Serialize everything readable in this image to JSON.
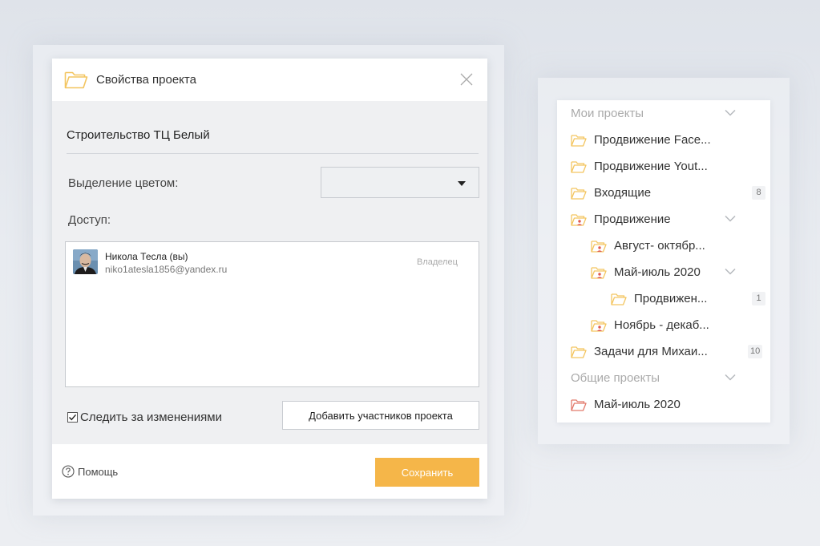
{
  "dialog": {
    "title": "Свойства проекта",
    "project_name": "Строительство ТЦ Белый",
    "color_label": "Выделение цветом:",
    "color_value": "",
    "access_label": "Доступ:",
    "members": [
      {
        "name": "Никола Тесла (вы)",
        "email": "niko1atesla1856@yandex.ru",
        "role": "Владелец"
      }
    ],
    "watch_changes_label": "Следить за изменениями",
    "watch_changes_checked": true,
    "add_members_label": "Добавить участников проекта",
    "help_label": "Помощь",
    "save_label": "Сохранить",
    "colors": {
      "accent": "#f5b649",
      "folder": "#f3c560"
    }
  },
  "tree": {
    "items": [
      {
        "label": "Мои проекты",
        "type": "section",
        "chevron": true
      },
      {
        "label": "Продвижение Face...",
        "type": "folder"
      },
      {
        "label": "Продвижение Yout...",
        "type": "folder"
      },
      {
        "label": "Входящие",
        "type": "folder",
        "badge": "8"
      },
      {
        "label": "Продвижение",
        "type": "shared-folder",
        "chevron": true
      },
      {
        "label": "Август- октябр...",
        "type": "shared-folder"
      },
      {
        "label": "Май-июль 2020",
        "type": "shared-folder",
        "chevron": true
      },
      {
        "label": "Продвижен...",
        "type": "folder",
        "badge": "1"
      },
      {
        "label": "Ноябрь - декаб...",
        "type": "shared-folder"
      },
      {
        "label": "Задачи для Михаи...",
        "type": "folder",
        "badge": "10"
      },
      {
        "label": "Общие проекты",
        "type": "section",
        "chevron": true
      },
      {
        "label": "Май-июль 2020",
        "type": "red-folder"
      }
    ]
  }
}
